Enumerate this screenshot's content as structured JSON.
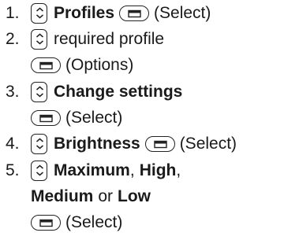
{
  "steps": [
    {
      "number": "1.",
      "line1": {
        "bold": "Profiles",
        "key_text": "(Select)"
      }
    },
    {
      "number": "2.",
      "line1": {
        "text": "required profile"
      },
      "line2": {
        "key_text": "(Options)"
      }
    },
    {
      "number": "3.",
      "line1": {
        "bold": "Change settings"
      },
      "line2": {
        "key_text": "(Select)"
      }
    },
    {
      "number": "4.",
      "line1": {
        "bold": "Brightness",
        "key_text": "(Select)"
      }
    },
    {
      "number": "5.",
      "line1": {
        "bold1": "Maximum",
        "sep1": ",",
        "bold2": "High",
        "sep2": ","
      },
      "line2": {
        "bold1": "Medium",
        "mid": "or",
        "bold2": "Low"
      },
      "line3": {
        "key_text": "(Select)"
      }
    }
  ],
  "icons": {
    "navigation_key": "navigation-key-icon",
    "selection_key": "selection-key-icon"
  }
}
